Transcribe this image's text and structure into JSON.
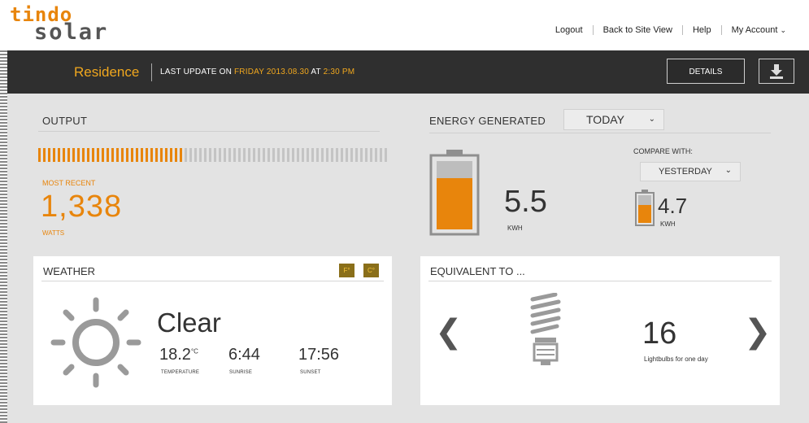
{
  "brand": {
    "line1": "tindo",
    "line2": "solar"
  },
  "top_links": {
    "logout": "Logout",
    "site_view": "Back to Site View",
    "help": "Help",
    "account": "My Account"
  },
  "status_bar": {
    "site": "Residence",
    "last_update_prefix": "LAST UPDATE ON",
    "last_update_day": "FRIDAY 2013.08.30",
    "last_update_at": "AT",
    "last_update_time": "2:30 PM",
    "details_label": "DETAILS"
  },
  "output": {
    "title": "OUTPUT",
    "level_fraction": 0.41,
    "most_recent_label": "MOST RECENT",
    "value": "1,338",
    "unit": "WATTS"
  },
  "energy": {
    "title": "ENERGY GENERATED",
    "period": "TODAY",
    "value": "5.5",
    "unit": "KWH",
    "battery_fill_fraction": 0.75,
    "compare_label": "COMPARE WITH:",
    "compare_period": "YESTERDAY",
    "compare_value": "4.7",
    "compare_unit": "KWH",
    "compare_battery_fill_fraction": 0.64
  },
  "weather": {
    "title": "WEATHER",
    "unit_f": "F°",
    "unit_c": "C°",
    "condition": "Clear",
    "temperature": "18.2",
    "temperature_unit": "°C",
    "temperature_label": "TEMPERATURE",
    "sunrise": "6:44",
    "sunrise_label": "SUNRISE",
    "sunset": "17:56",
    "sunset_label": "SUNSET"
  },
  "equivalent": {
    "title": "EQUIVALENT TO ...",
    "value": "16",
    "label": "Lightbulbs for one day"
  },
  "colors": {
    "accent": "#e8850c",
    "dark_bar": "#2f2f2f",
    "panel": "#e3e3e3",
    "inactive_bar": "#c4c4c4"
  }
}
